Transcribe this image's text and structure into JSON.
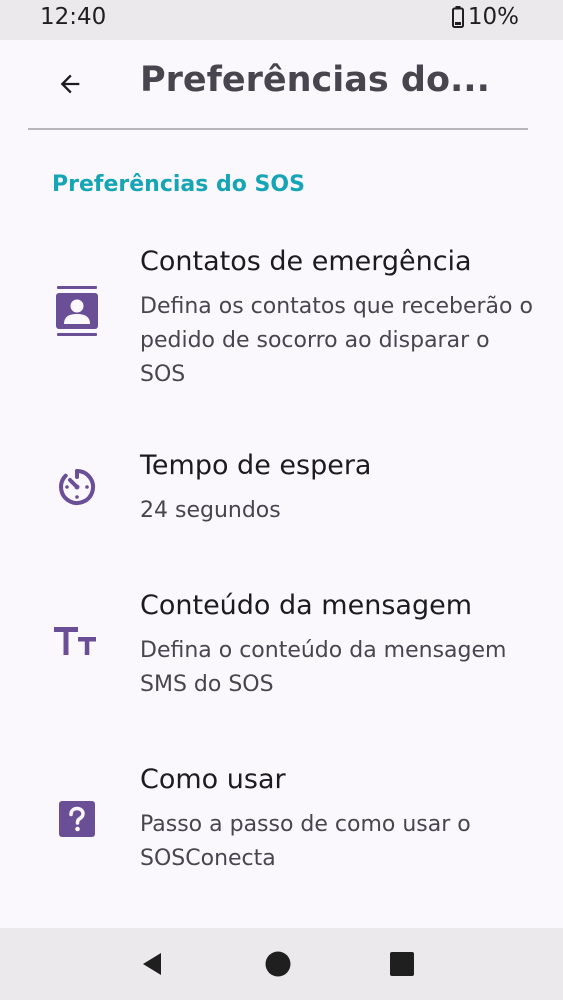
{
  "status_bar": {
    "time": "12:40",
    "battery": "10%",
    "battery_icon": "battery-low-icon"
  },
  "app_bar": {
    "title": "Preferências do...",
    "back_icon": "arrow-back-icon"
  },
  "section": {
    "header": "Preferências do SOS"
  },
  "preferences": [
    {
      "icon": "contact-card-icon",
      "title": "Contatos de emergência",
      "summary": "Defina os contatos que receberão o pedido de socorro ao disparar o SOS"
    },
    {
      "icon": "timer-icon",
      "title": "Tempo de espera",
      "summary": "24 segundos"
    },
    {
      "icon": "text-size-icon",
      "title": "Conteúdo da mensagem",
      "summary": "Defina o conteúdo da mensagem SMS do SOS"
    },
    {
      "icon": "help-icon",
      "title": "Como usar",
      "summary": "Passo a passo de como usar o SOSConecta"
    }
  ],
  "nav_bar": {
    "back_icon": "nav-back-icon",
    "home_icon": "nav-home-icon",
    "recents_icon": "nav-recents-icon"
  },
  "colors": {
    "accent": "#16a5b5",
    "icon_tint": "#6b4f96",
    "background": "#fbf8fd",
    "system_bar": "#ebe9ec"
  }
}
